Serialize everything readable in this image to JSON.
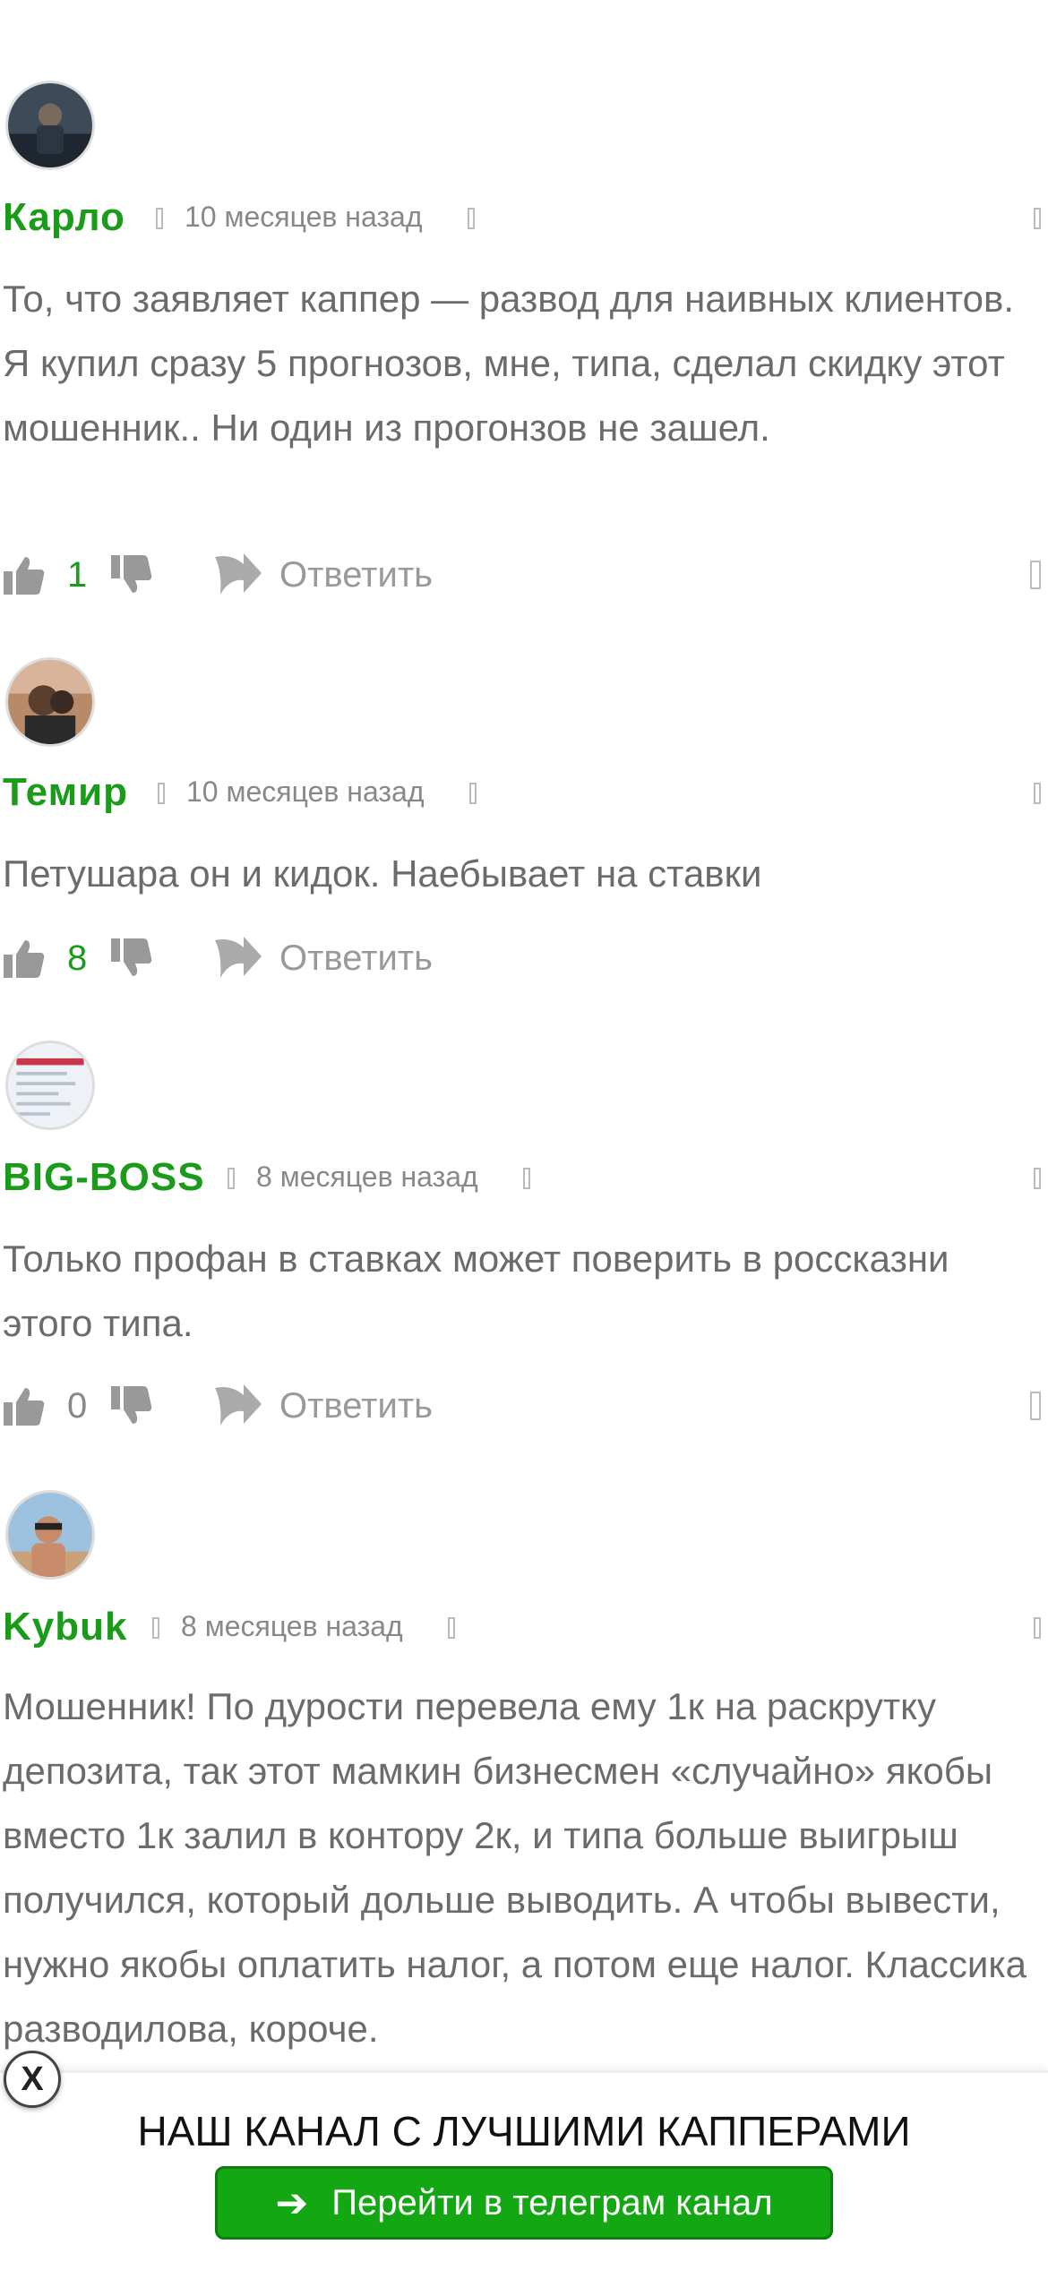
{
  "comments": [
    {
      "author": "Карло",
      "time": "10 месяцев назад",
      "text": "То, что заявляет каппер — развод для наивных клиентов. Я купил сразу 5 прогнозов, мне, типа, сделал скидку этот мошенник.. Ни один из прогонзов не зашел.",
      "votes": "1",
      "vote_color": "#1a9b1a",
      "reply_label": "Ответить"
    },
    {
      "author": "Темир",
      "time": "10 месяцев назад",
      "text": "Петушара он и кидок. Наебывает на ставки",
      "votes": "8",
      "vote_color": "#1a9b1a",
      "reply_label": "Ответить"
    },
    {
      "author": "BIG-BOSS",
      "time": "8 месяцев назад",
      "text": "Только профан в ставках может поверить в россказни этого типа.",
      "votes": "0",
      "vote_color": "#888888",
      "reply_label": "Ответить"
    },
    {
      "author": "Kybuk",
      "time": "8 месяцев назад",
      "text": "Мошенник! По дурости перевела ему 1к на раскрутку депозита, так этот мамкин бизнесмен «случайно» якобы вместо 1к залил в контору 2к, и типа больше выигрыш получился, который дольше выводить. А чтобы вывести, нужно якобы оплатить налог, а потом еще налог. Классика разводилова, короче."
    }
  ],
  "banner": {
    "title": "НАШ КАНАЛ С ЛУЧШИМИ КАППЕРАМИ",
    "button_label": "Перейти в телеграм канал",
    "close_label": "X"
  },
  "colors": {
    "accent_green": "#1a9b1a",
    "button_green": "#13a813"
  }
}
